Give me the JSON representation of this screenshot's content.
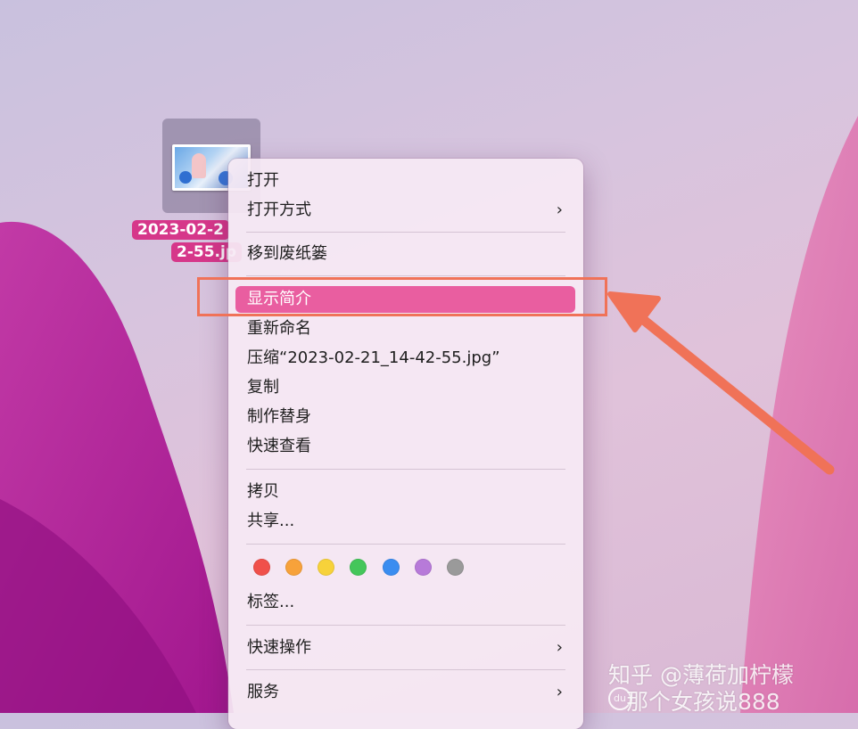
{
  "file": {
    "label_line1": "2023-02-2",
    "label_line2": "2-55.jp"
  },
  "menu": {
    "open": "打开",
    "open_with": "打开方式",
    "move_to_trash": "移到废纸篓",
    "get_info": "显示简介",
    "rename": "重新命名",
    "compress": "压缩“2023-02-21_14-42-55.jpg”",
    "duplicate": "复制",
    "make_alias": "制作替身",
    "quick_look": "快速查看",
    "copy": "拷贝",
    "share": "共享...",
    "tags": "标签...",
    "quick_actions": "快速操作",
    "services": "服务",
    "submenu_chevron": "›"
  },
  "tag_colors": [
    "#f0504a",
    "#f7a23a",
    "#f7d23a",
    "#44c65a",
    "#3a8df0",
    "#b77ad9",
    "#9a9a9a"
  ],
  "annotation": {
    "color": "#f07258"
  },
  "watermark": {
    "line1": "知乎 @薄荷加柠檬",
    "badge": "du",
    "line2": "那个女孩说888"
  }
}
